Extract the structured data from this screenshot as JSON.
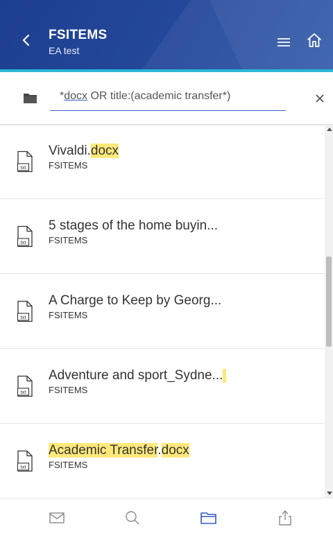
{
  "header": {
    "title": "FSITEMS",
    "subtitle": "EA test",
    "background_color": "#24489b",
    "accent_color": "#2bb7d8"
  },
  "search": {
    "query_prefix": "*",
    "query_underlined": "docx",
    "query_rest": " OR title:(academic transfer*)",
    "highlight_color": "#ffe97a"
  },
  "results": [
    {
      "name_parts": [
        {
          "text": "Vivaldi",
          "hl": false
        },
        {
          "text": ".",
          "hl": false
        },
        {
          "text": "docx",
          "hl": true
        }
      ],
      "source": "FSITEMS",
      "icon": "txt"
    },
    {
      "name_parts": [
        {
          "text": "5 stages of the home buyin...",
          "hl": false
        }
      ],
      "source": "FSITEMS",
      "icon": "txt"
    },
    {
      "name_parts": [
        {
          "text": "A Charge to Keep by Georg...",
          "hl": false
        }
      ],
      "source": "FSITEMS",
      "icon": "txt"
    },
    {
      "name_parts": [
        {
          "text": "Adventure and sport_Sydne...",
          "hl": false
        }
      ],
      "source": "FSITEMS",
      "icon": "txt"
    },
    {
      "name_parts": [
        {
          "text": "Academic Transfer",
          "hl": true
        },
        {
          "text": ".",
          "hl": false
        },
        {
          "text": "docx",
          "hl": true
        }
      ],
      "source": "FSITEMS",
      "icon": "txt"
    }
  ],
  "bottom_nav": [
    {
      "icon": "mail-icon"
    },
    {
      "icon": "search-icon"
    },
    {
      "icon": "folder-icon",
      "active": true
    },
    {
      "icon": "share-icon"
    }
  ],
  "icons": {
    "back": "chevron-left-icon",
    "menu": "hamburger-menu-icon",
    "home": "home-icon",
    "folder": "folder-icon",
    "clear": "close-icon",
    "file": "txt-file-icon"
  }
}
